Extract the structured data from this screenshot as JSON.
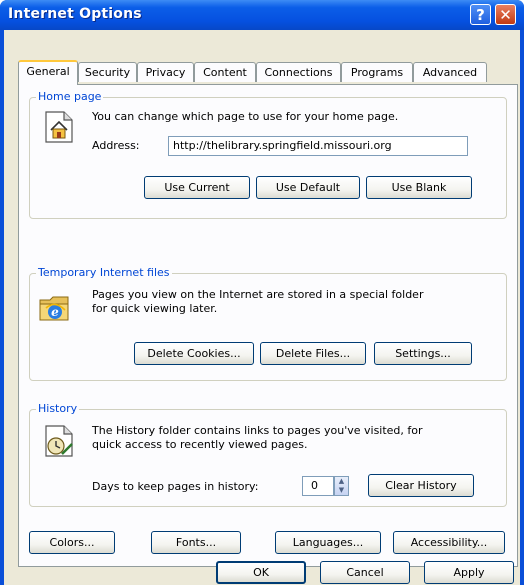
{
  "window": {
    "title": "Internet Options",
    "help_label": "?",
    "close_label": "✕"
  },
  "tabs": [
    "General",
    "Security",
    "Privacy",
    "Content",
    "Connections",
    "Programs",
    "Advanced"
  ],
  "home_page": {
    "title": "Home page",
    "description": "You can change which page to use for your home page.",
    "address_label": "Address:",
    "address_value": "http://thelibrary.springfield.missouri.org",
    "use_current": "Use Current",
    "use_default": "Use Default",
    "use_blank": "Use Blank",
    "icon": "home-page-icon"
  },
  "temp_files": {
    "title": "Temporary Internet files",
    "description_line1": "Pages you view on the Internet are stored in a special folder",
    "description_line2": "for quick viewing later.",
    "delete_cookies": "Delete Cookies...",
    "delete_files": "Delete Files...",
    "settings": "Settings...",
    "icon": "ie-folder-icon"
  },
  "history": {
    "title": "History",
    "description_line1": "The History folder contains links to pages you've visited, for",
    "description_line2": "quick access to recently viewed pages.",
    "days_label": "Days to keep pages in history:",
    "days_value": "0",
    "clear_history": "Clear History",
    "icon": "history-icon"
  },
  "bottom_buttons": {
    "colors": "Colors...",
    "fonts": "Fonts...",
    "languages": "Languages...",
    "accessibility": "Accessibility..."
  },
  "dialog_buttons": {
    "ok": "OK",
    "cancel": "Cancel",
    "apply": "Apply"
  },
  "colors": {
    "title_bar": "#0b5ee8",
    "dialog_face": "#ece9d8",
    "group_title": "#0046d5",
    "active_tab_accent": "#ffc83c"
  }
}
